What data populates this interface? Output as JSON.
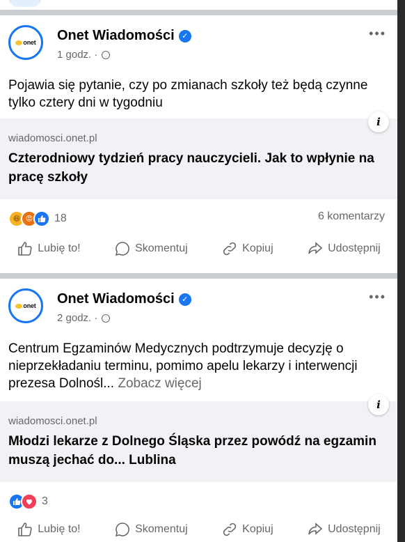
{
  "posts": [
    {
      "page_name": "Onet Wiadomości",
      "avatar_text": "onet",
      "time": "1 godz. ·",
      "text": "Pojawia się pytanie, czy po zmianach szkoły też będą czynne tylko cztery dni w tygodniu",
      "see_more": "",
      "link_domain": "wiadomosci.onet.pl",
      "link_title": "Czterodniowy tydzień pracy nauczycieli. Jak to wpłynie na pracę szkoły",
      "reaction_count": "18",
      "comments": "6 komentarzy"
    },
    {
      "page_name": "Onet Wiadomości",
      "avatar_text": "onet",
      "time": "2 godz. ·",
      "text": "Centrum Egzaminów Medycznych podtrzymuje decyzję o nieprzekładaniu terminu, pomimo apelu lekarzy i interwencji prezesa Dolnośl...",
      "see_more": "Zobacz więcej",
      "link_domain": "wiadomosci.onet.pl",
      "link_title": "Młodzi lekarze z Dolnego Śląska przez powódź na egzamin muszą jechać do... Lublina",
      "reaction_count": "3",
      "comments": ""
    }
  ],
  "actions": {
    "like": "Lubię to!",
    "comment": "Skomentuj",
    "copy": "Kopiuj",
    "share": "Udostępnij"
  },
  "colors": {
    "brand_blue": "#1876f2",
    "secondary_text": "#65676b",
    "link_box_bg": "#f0f2f5"
  }
}
